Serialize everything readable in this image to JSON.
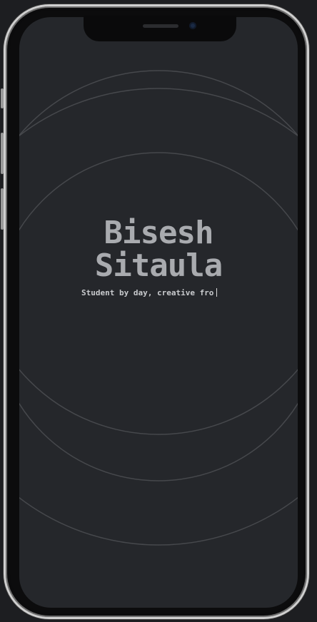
{
  "profile": {
    "first_name": "Bisesh",
    "last_name": "Sitaula",
    "tagline": "Student by day, creative fro"
  },
  "theme": {
    "screen_background": "#25272b",
    "name_color": "#a9abaf",
    "ring_color": "#4a4c50",
    "frame_color": "#cfcfcf"
  }
}
